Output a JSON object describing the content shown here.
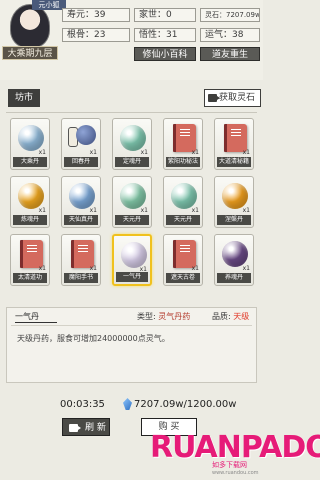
{
  "header": {
    "avatar_tag": "元小狐",
    "realm": "大乘期九层",
    "stats": [
      {
        "label": "寿元",
        "value": "39"
      },
      {
        "label": "家世",
        "value": "0"
      },
      {
        "label": "灵石",
        "value": "7207.09w"
      },
      {
        "label": "根骨",
        "value": "23"
      },
      {
        "label": "悟性",
        "value": "31"
      },
      {
        "label": "运气",
        "value": "38"
      }
    ],
    "mid_button": "修仙小百科",
    "right_button": "道友重生"
  },
  "shop": {
    "tag": "坊市",
    "get_stone_label": "获取灵石"
  },
  "items": [
    {
      "name": "大乘丹",
      "qty": "x1",
      "kind": "orb",
      "color": "#8fb8d8"
    },
    {
      "name": "回春丹",
      "qty": "x1",
      "kind": "bag",
      "color": "#3a4a7a"
    },
    {
      "name": "定魂丹",
      "qty": "x1",
      "kind": "orb",
      "color": "#7fc8b0"
    },
    {
      "name": "紫阳功秘法",
      "qty": "x1",
      "kind": "book",
      "color": "#d46a5e"
    },
    {
      "name": "大道清秘籍",
      "qty": "x1",
      "kind": "book",
      "color": "#d46a5e"
    },
    {
      "name": "炼魂丹",
      "qty": "x1",
      "kind": "orb",
      "color": "#f0a820"
    },
    {
      "name": "天仙真丹",
      "qty": "x1",
      "kind": "orb",
      "color": "#7aa6d6"
    },
    {
      "name": "天元丹",
      "qty": "x1",
      "kind": "orb",
      "color": "#82c8a8"
    },
    {
      "name": "天元丹",
      "qty": "x1",
      "kind": "orb",
      "color": "#7fc8b0"
    },
    {
      "name": "涅槃丹",
      "qty": "x1",
      "kind": "orb",
      "color": "#f0a020"
    },
    {
      "name": "太清道功",
      "qty": "x1",
      "kind": "book",
      "color": "#d46a5e"
    },
    {
      "name": "魔阳手书",
      "qty": "x1",
      "kind": "book",
      "color": "#d46a5e"
    },
    {
      "name": "一气丹",
      "qty": "x1",
      "kind": "orb",
      "color": "#d7cde8"
    },
    {
      "name": "遮天古卷",
      "qty": "x1",
      "kind": "book",
      "color": "#d46a5e"
    },
    {
      "name": "养魂丹",
      "qty": "x1",
      "kind": "orb",
      "color": "#6a4a86"
    }
  ],
  "selected_index": 12,
  "detail": {
    "name": "一气丹",
    "type_label": "类型:",
    "type_value": "灵气丹药",
    "quality_label": "品质:",
    "quality_value": "天级",
    "description": "天级丹药，服食可增加24000000点灵气。"
  },
  "footer": {
    "timer": "00:03:35",
    "stone": "7207.09w/1200.00w",
    "refresh_label": "刷 新",
    "buy_label": "购 买"
  },
  "watermark": {
    "main": "RUANPADO",
    "sub": "如多下载网",
    "url": "www.ruandou.com"
  },
  "colors": {
    "accent_dark": "#4a4a46",
    "selection": "#f0c11d",
    "quality_red": "#e23b2a"
  }
}
